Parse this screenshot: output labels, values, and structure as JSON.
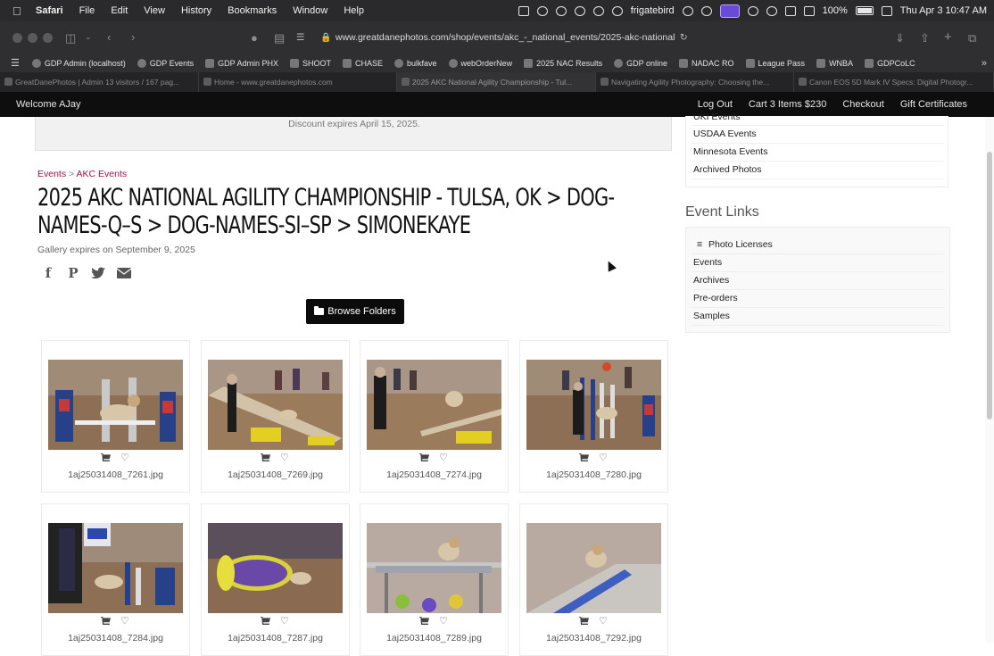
{
  "menubar": {
    "apple": "",
    "items": [
      "Safari",
      "File",
      "Edit",
      "View",
      "History",
      "Bookmarks",
      "Window",
      "Help"
    ],
    "user": "frigatebird",
    "battery": "100%",
    "datetime": "Thu Apr 3  10:47 AM"
  },
  "toolbar": {
    "url": "www.greatdanephotos.com/shop/events/akc_-_national_events/2025-akc-national"
  },
  "bookmarks": [
    "GDP Admin (localhost)",
    "GDP Events",
    "GDP Admin PHX",
    "SHOOT",
    "CHASE",
    "bulkfave",
    "webOrderNew",
    "2025 NAC Results",
    "GDP online",
    "NADAC RO",
    "League Pass",
    "WNBA",
    "GDPCoLC"
  ],
  "tabs": [
    "GreatDanePhotos | Admin 13 visitors / 167 pag...",
    "Home - www.greatdanephotos.com",
    "2025 AKC National Agility Championship - Tul...",
    "Navigating Agility Photography: Choosing the...",
    "Canon EOS 5D Mark IV Specs: Digital Photogr..."
  ],
  "sitenav": {
    "welcome": "Welcome AJay",
    "logout": "Log Out",
    "cart": "Cart 3 Items $230",
    "checkout": "Checkout",
    "gift": "Gift Certificates"
  },
  "discount": "Discount expires April 15, 2025.",
  "breadcrumb": {
    "events": "Events",
    "sep": " > ",
    "akc": "AKC Events"
  },
  "title": "2025 AKC NATIONAL AGILITY CHAMPIONSHIP - TULSA, OK > DOG-NAMES-Q–S > DOG-NAMES-SI–SP > SIMONEKAYE",
  "gallery_expires": "Gallery expires on September 9, 2025",
  "browse_label": "Browse Folders",
  "photos": [
    "1aj25031408_7261.jpg",
    "1aj25031408_7269.jpg",
    "1aj25031408_7274.jpg",
    "1aj25031408_7280.jpg",
    "1aj25031408_7284.jpg",
    "1aj25031408_7287.jpg",
    "1aj25031408_7289.jpg",
    "1aj25031408_7292.jpg"
  ],
  "sidebar": {
    "list1": [
      "UKI Events",
      "USDAA Events",
      "Minnesota Events",
      "Archived Photos"
    ],
    "event_links_title": "Event Links",
    "list2": [
      "Photo Licenses",
      "Events",
      "Archives",
      "Pre-orders",
      "Samples"
    ]
  },
  "colors": {
    "link": "#a3134a",
    "nav_bg": "#0e0e0f",
    "button_bg": "#0b0b0b"
  }
}
